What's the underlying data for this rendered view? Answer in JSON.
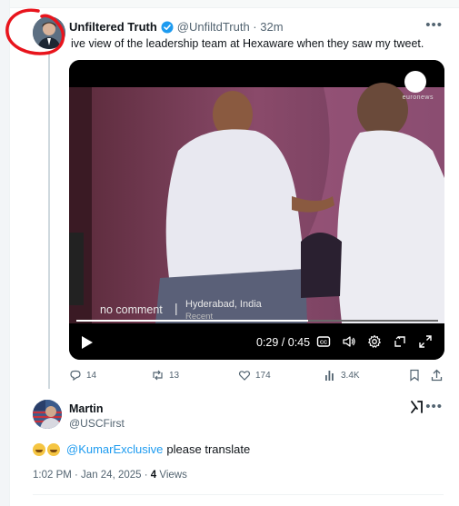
{
  "tweet": {
    "display_name": "Unfiltered Truth",
    "handle": "@UnfiltdTruth",
    "time": "32m",
    "text": "ive view of the leadership team at Hexaware when they saw my tweet.",
    "video": {
      "watermark": "euronews",
      "caption": "no comment",
      "location": "Hyderabad, India",
      "location_sub": "Recent",
      "time_display": "0:29 / 0:45",
      "progress_fraction": 0.64,
      "cc_label": "CC"
    },
    "actions": {
      "replies": "14",
      "reposts": "13",
      "likes": "174",
      "views": "3.4K"
    }
  },
  "reply": {
    "display_name": "Martin",
    "handle": "@USCFirst",
    "mention": "@KumarExclusive",
    "text": "please translate",
    "timestamp": "1:02 PM · Jan 24, 2025 · ",
    "views_count": "4",
    "views_label": " Views",
    "grok_label": "X⁄"
  },
  "colors": {
    "accent": "#1d9bf0",
    "annotation": "#e8141c",
    "muted": "#536471"
  }
}
